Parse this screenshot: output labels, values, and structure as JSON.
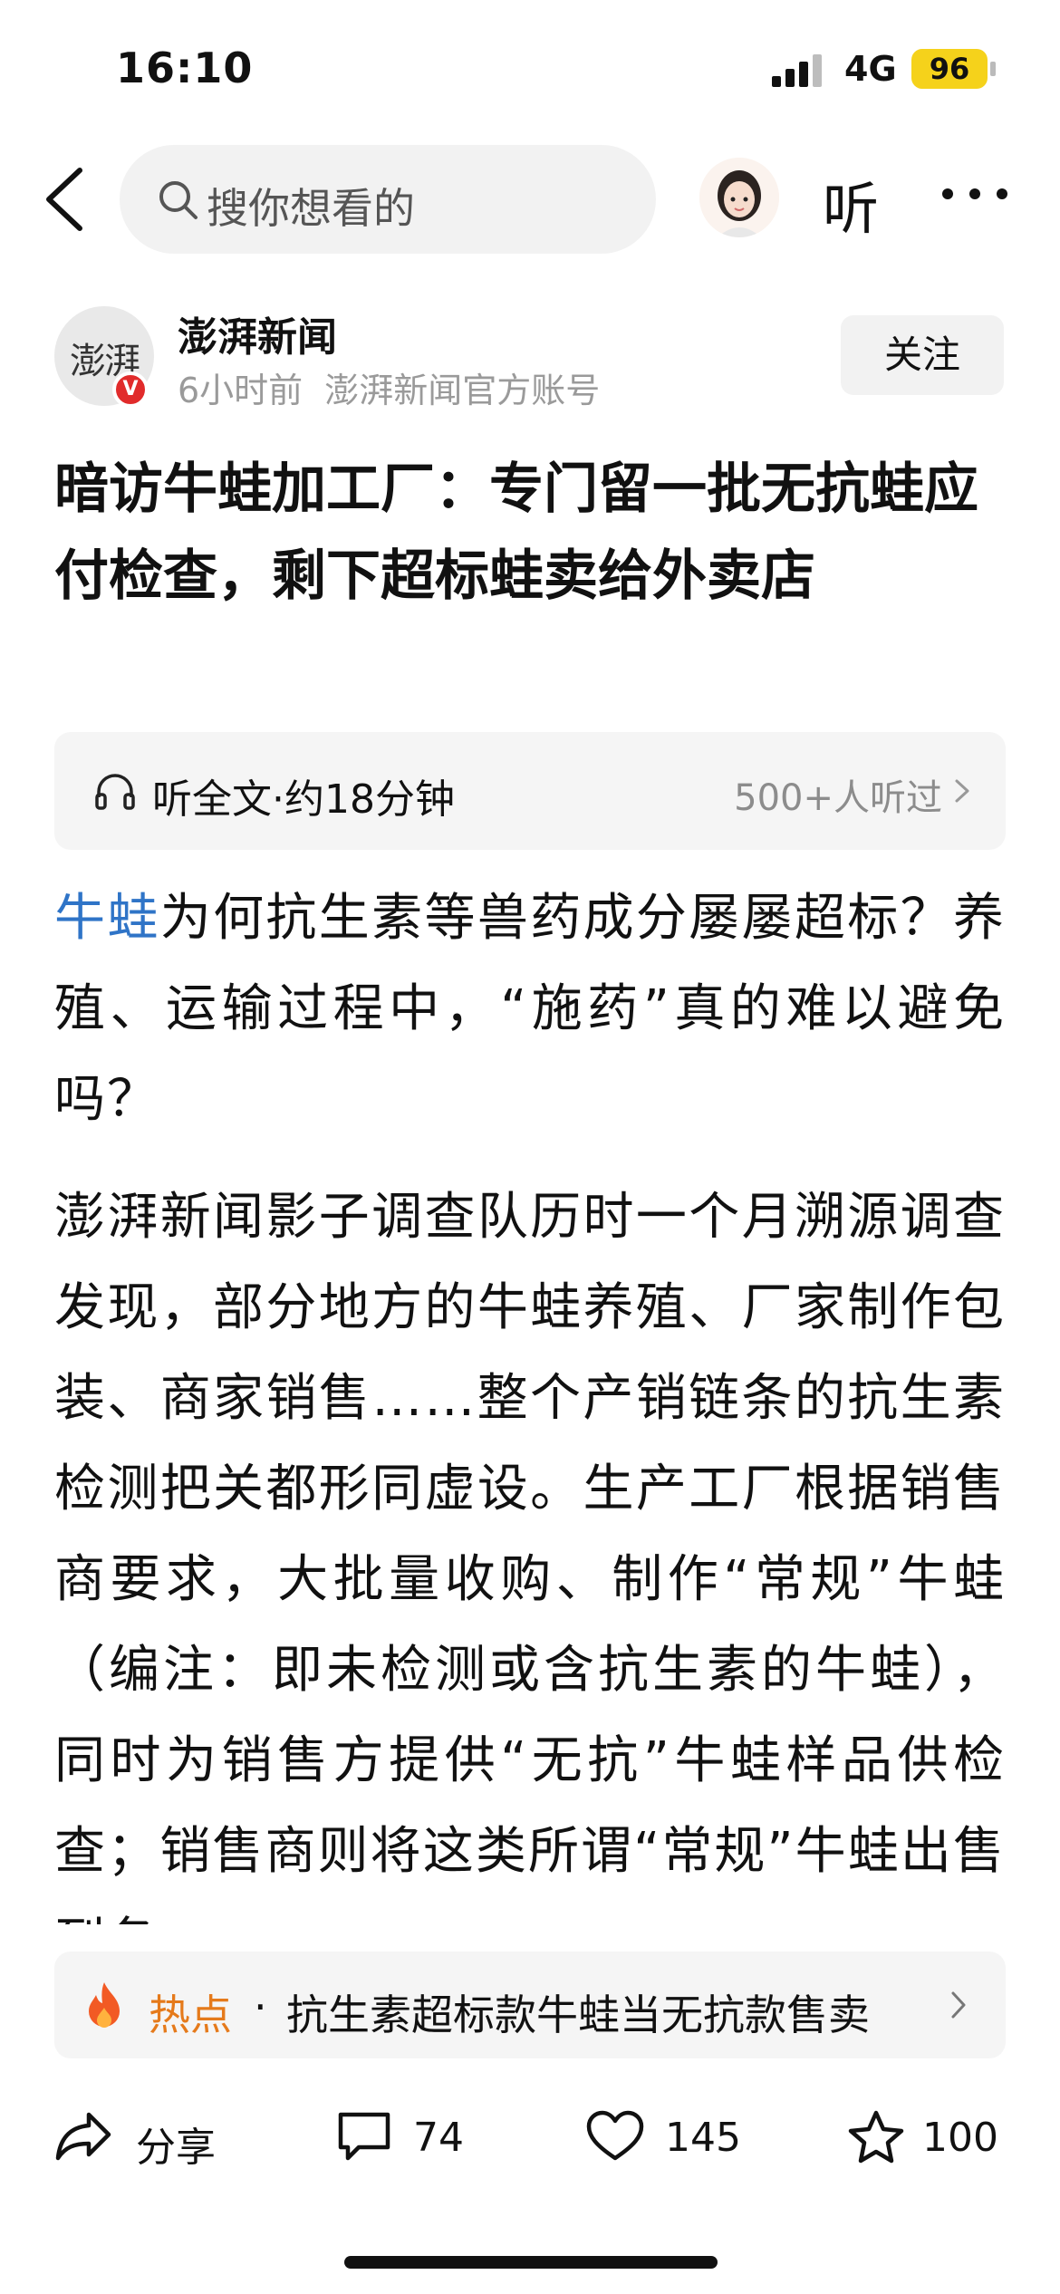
{
  "status_bar": {
    "time": "16:10",
    "network": "4G",
    "battery": "96",
    "battery_color": "#f5d21b"
  },
  "nav": {
    "search_placeholder": "搜你想看的",
    "listen_label": "听",
    "icons": [
      "back-arrow-icon",
      "search-icon",
      "avatar",
      "more-icon"
    ]
  },
  "author": {
    "logo_text": "澎湃",
    "verified_badge": "V",
    "name": "澎湃新闻",
    "time_ago": "6小时前",
    "account_type": "澎湃新闻官方账号",
    "follow_label": "关注"
  },
  "article": {
    "title": "暗访牛蛙加工厂：专门留一批无抗蛙应付检查，剩下超标蛙卖给外卖店",
    "listen": {
      "label": "听全文",
      "duration": "·约18分钟",
      "listened": "500+人听过"
    },
    "paragraph1_link": "牛蛙",
    "paragraph1_rest": "为何抗生素等兽药成分屡屡超标？养殖、运输过程中，“施药”真的难以避免吗？",
    "paragraph2": "澎湃新闻影子调查队历时一个月溯源调查发现，部分地方的牛蛙养殖、厂家制作包装、商家销售……整个产销链条的抗生素检测把关都形同虚设。生产工厂根据销售商要求，大批量收购、制作“常规”牛蛙（编注：即未检测或含抗生素的牛蛙），同时为销售方提供“无抗”牛蛙样品供检查；销售商则将这类所谓“常规”牛蛙出售到各"
  },
  "hot": {
    "label": "热点",
    "dot": "·",
    "text": "抗生素超标款牛蛙当无抗款售卖",
    "accent": "#e57a1b"
  },
  "toolbar": {
    "share_label": "分享",
    "comments": "74",
    "likes": "145",
    "favorites": "100"
  },
  "colors": {
    "link": "#2f74c7",
    "muted": "#9a9a9a",
    "badge_red": "#e12b2b"
  }
}
